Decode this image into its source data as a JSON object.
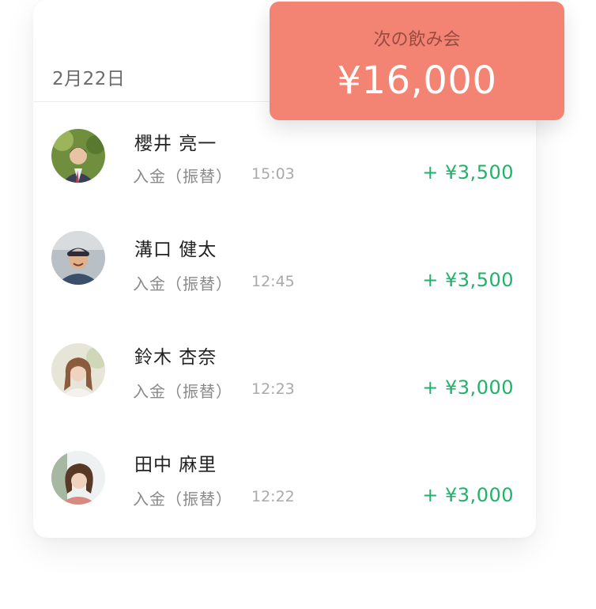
{
  "summary": {
    "label": "次の飲み会",
    "amount": "¥16,000"
  },
  "date": "2月22日",
  "transactions": [
    {
      "name": "櫻井 亮一",
      "method": "入金（振替）",
      "time": "15:03",
      "amount": "+ ¥3,500",
      "avatar": "person-avatar-icon"
    },
    {
      "name": "溝口 健太",
      "method": "入金（振替）",
      "time": "12:45",
      "amount": "+ ¥3,500",
      "avatar": "person-avatar-icon"
    },
    {
      "name": "鈴木 杏奈",
      "method": "入金（振替）",
      "time": "12:23",
      "amount": "+ ¥3,000",
      "avatar": "person-avatar-icon"
    },
    {
      "name": "田中 麻里",
      "method": "入金（振替）",
      "time": "12:22",
      "amount": "+ ¥3,000",
      "avatar": "person-avatar-icon"
    }
  ],
  "colors": {
    "accent": "#f38474",
    "income": "#21b26a"
  }
}
